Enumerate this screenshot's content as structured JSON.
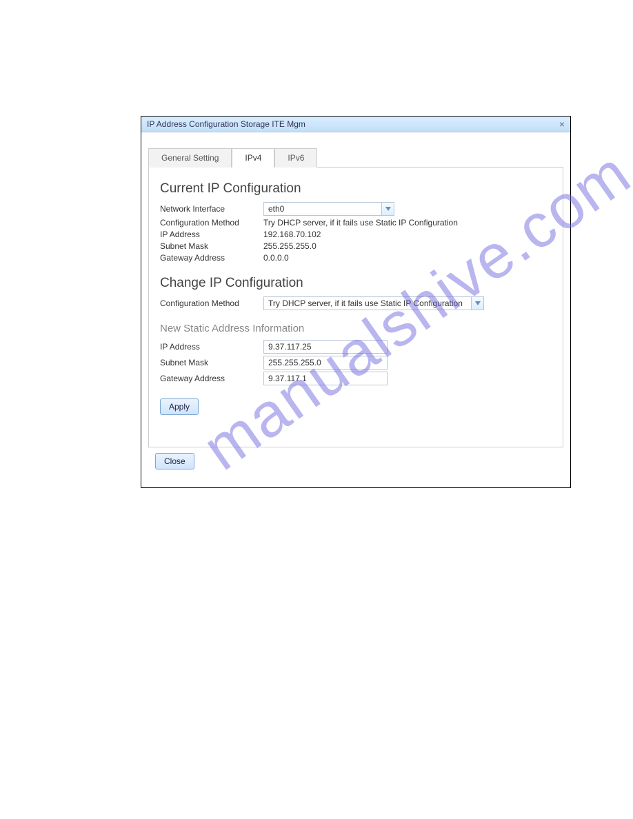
{
  "watermark": "manualshive.com",
  "dialog": {
    "title": "IP Address Configuration Storage ITE Mgm",
    "tabs": {
      "general": "General Setting",
      "ipv4": "IPv4",
      "ipv6": "IPv6"
    },
    "current": {
      "heading": "Current IP Configuration",
      "network_interface_label": "Network Interface",
      "network_interface_value": "eth0",
      "config_method_label": "Configuration Method",
      "config_method_value": "Try DHCP server, if it fails use Static IP Configuration",
      "ip_address_label": "IP Address",
      "ip_address_value": "192.168.70.102",
      "subnet_mask_label": "Subnet Mask",
      "subnet_mask_value": "255.255.255.0",
      "gateway_label": "Gateway Address",
      "gateway_value": "0.0.0.0"
    },
    "change": {
      "heading": "Change IP Configuration",
      "config_method_label": "Configuration Method",
      "config_method_value": "Try DHCP server, if it fails use Static IP Configuration"
    },
    "new_static": {
      "heading": "New Static Address Information",
      "ip_address_label": "IP Address",
      "ip_address_value": "9.37.117.25",
      "subnet_mask_label": "Subnet Mask",
      "subnet_mask_value": "255.255.255.0",
      "gateway_label": "Gateway Address",
      "gateway_value": "9.37.117.1"
    },
    "apply_label": "Apply",
    "close_label": "Close"
  }
}
